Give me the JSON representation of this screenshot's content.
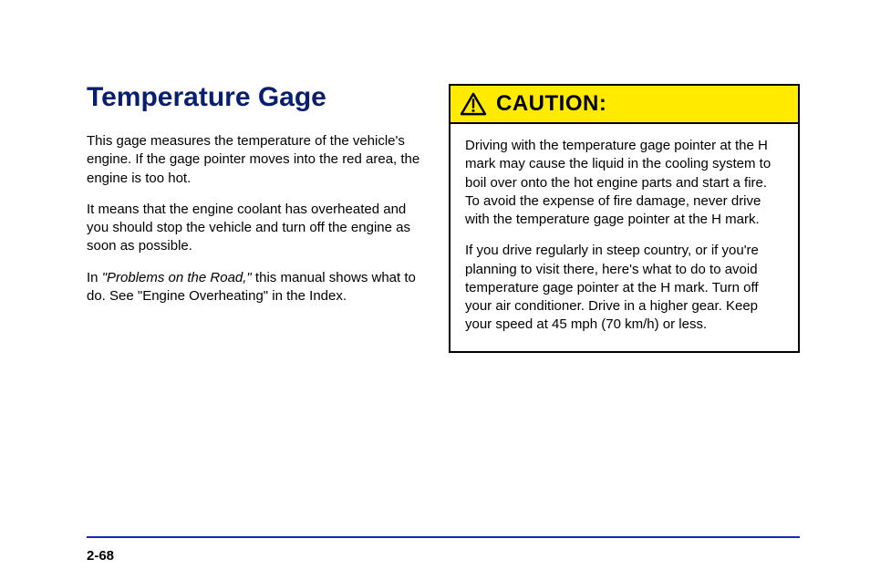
{
  "title": "Temperature Gage",
  "left_paragraphs": [
    "This gage measures the temperature of the vehicle's engine. If the gage pointer moves into the red area, the engine is too hot.",
    "It means that the engine coolant has overheated and you should stop the vehicle and turn off the engine as soon as possible."
  ],
  "xref_prefix": "In ",
  "xref_link": "\"Problems on the Road,\"",
  "xref_suffix": " this manual shows what to do. See \"Engine Overheating\" in the Index.",
  "caution": {
    "label": "CAUTION:",
    "paragraphs": [
      "Driving with the temperature gage pointer at the H mark may cause the liquid in the cooling system to boil over onto the hot engine parts and start a fire. To avoid the expense of fire damage, never drive with the temperature gage pointer at the H mark.",
      "If you drive regularly in steep country, or if you're planning to visit there, here's what to do to avoid temperature gage pointer at the H mark. Turn off your air conditioner. Drive in a higher gear. Keep your speed at 45 mph (70 km/h) or less."
    ]
  },
  "page_number": "2-68"
}
